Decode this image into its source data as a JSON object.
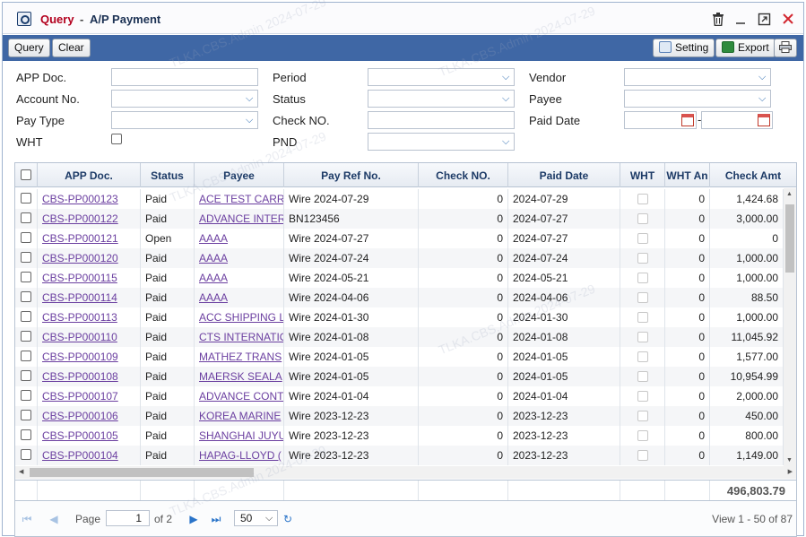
{
  "window": {
    "title_main": "Query",
    "title_sep": "-",
    "title_sub": "A/P Payment"
  },
  "toolbar": {
    "query_label": "Query",
    "clear_label": "Clear",
    "setting_label": "Setting",
    "export_label": "Export"
  },
  "form": {
    "app_doc_label": "APP Doc.",
    "account_no_label": "Account No.",
    "pay_type_label": "Pay Type",
    "wht_label": "WHT",
    "period_label": "Period",
    "status_label": "Status",
    "check_no_label": "Check NO.",
    "pnd_label": "PND",
    "vendor_label": "Vendor",
    "payee_label": "Payee",
    "paid_date_label": "Paid Date",
    "date_range_sep": "-"
  },
  "grid": {
    "columns": [
      "APP Doc.",
      "Status",
      "Payee",
      "Pay Ref No.",
      "Check NO.",
      "Paid Date",
      "WHT",
      "WHT An",
      "Check Amt"
    ],
    "rows": [
      {
        "doc": "CBS-PP000123",
        "status": "Paid",
        "payee": "ACE TEST CARR",
        "ref": "Wire 2024-07-29",
        "check": "0",
        "date": "2024-07-29",
        "whtamt": "0",
        "amt": "1,424.68"
      },
      {
        "doc": "CBS-PP000122",
        "status": "Paid",
        "payee": "ADVANCE INTER",
        "ref": "BN123456",
        "check": "0",
        "date": "2024-07-27",
        "whtamt": "0",
        "amt": "3,000.00"
      },
      {
        "doc": "CBS-PP000121",
        "status": "Open",
        "payee": "AAAA",
        "ref": "Wire 2024-07-27",
        "check": "0",
        "date": "2024-07-27",
        "whtamt": "0",
        "amt": "0"
      },
      {
        "doc": "CBS-PP000120",
        "status": "Paid",
        "payee": "AAAA",
        "ref": "Wire 2024-07-24",
        "check": "0",
        "date": "2024-07-24",
        "whtamt": "0",
        "amt": "1,000.00"
      },
      {
        "doc": "CBS-PP000115",
        "status": "Paid",
        "payee": "AAAA",
        "ref": "Wire 2024-05-21",
        "check": "0",
        "date": "2024-05-21",
        "whtamt": "0",
        "amt": "1,000.00"
      },
      {
        "doc": "CBS-PP000114",
        "status": "Paid",
        "payee": "AAAA",
        "ref": "Wire 2024-04-06",
        "check": "0",
        "date": "2024-04-06",
        "whtamt": "0",
        "amt": "88.50"
      },
      {
        "doc": "CBS-PP000113",
        "status": "Paid",
        "payee": "ACC SHIPPING L",
        "ref": "Wire 2024-01-30",
        "check": "0",
        "date": "2024-01-30",
        "whtamt": "0",
        "amt": "1,000.00"
      },
      {
        "doc": "CBS-PP000110",
        "status": "Paid",
        "payee": "CTS INTERNATIO",
        "ref": "Wire 2024-01-08",
        "check": "0",
        "date": "2024-01-08",
        "whtamt": "0",
        "amt": "11,045.92"
      },
      {
        "doc": "CBS-PP000109",
        "status": "Paid",
        "payee": "MATHEZ TRANS",
        "ref": "Wire 2024-01-05",
        "check": "0",
        "date": "2024-01-05",
        "whtamt": "0",
        "amt": "1,577.00"
      },
      {
        "doc": "CBS-PP000108",
        "status": "Paid",
        "payee": "MAERSK SEALA",
        "ref": "Wire 2024-01-05",
        "check": "0",
        "date": "2024-01-05",
        "whtamt": "0",
        "amt": "10,954.99"
      },
      {
        "doc": "CBS-PP000107",
        "status": "Paid",
        "payee": "ADVANCE CONT",
        "ref": "Wire 2024-01-04",
        "check": "0",
        "date": "2024-01-04",
        "whtamt": "0",
        "amt": "2,000.00"
      },
      {
        "doc": "CBS-PP000106",
        "status": "Paid",
        "payee": "KOREA MARINE",
        "ref": "Wire 2023-12-23",
        "check": "0",
        "date": "2023-12-23",
        "whtamt": "0",
        "amt": "450.00"
      },
      {
        "doc": "CBS-PP000105",
        "status": "Paid",
        "payee": "SHANGHAI JUYU",
        "ref": "Wire 2023-12-23",
        "check": "0",
        "date": "2023-12-23",
        "whtamt": "0",
        "amt": "800.00"
      },
      {
        "doc": "CBS-PP000104",
        "status": "Paid",
        "payee": "HAPAG-LLOYD (",
        "ref": "Wire 2023-12-23",
        "check": "0",
        "date": "2023-12-23",
        "whtamt": "0",
        "amt": "1,149.00"
      }
    ],
    "total": "496,803.79"
  },
  "pager": {
    "page_label": "Page",
    "page_value": "1",
    "of_label": "of 2",
    "page_size": "50",
    "page_size_options": [
      "50"
    ],
    "view_text": "View 1 - 50 of 87"
  },
  "watermark": "TLKA.CBS.Admin 2024-07-29",
  "colors": {
    "toolbar": "#3f67a5",
    "title": "#b3001e",
    "link": "#6b3fa0"
  }
}
